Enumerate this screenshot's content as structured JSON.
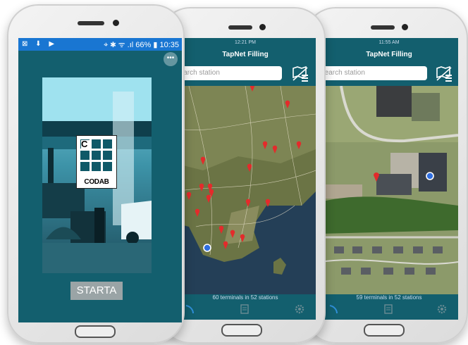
{
  "android": {
    "status_left": "⊠ ⬇ ▶",
    "status_right": "⌖ ✱ ᯤ .ıl 66% ▮ 10:35",
    "logo_letter": "C",
    "logo_name": "CODAB",
    "start_label": "STARTA"
  },
  "map_app": {
    "time": "12:21 PM",
    "title": "TapNet Filling",
    "search_placeholder": "Search station",
    "footer": "60 terminals in 52 stations"
  },
  "detail_app": {
    "time": "11:55 AM",
    "title": "TapNet Filling",
    "search_placeholder": "Search station",
    "footer": "59 terminals in 52 stations"
  },
  "colors": {
    "teal": "#135f6e",
    "status_blue": "#1976d2",
    "pin_red": "#e32b2b",
    "user_blue": "#2f6ee0"
  },
  "icons": [
    "map-list-icon",
    "navigation-icon",
    "list-icon",
    "settings-icon"
  ]
}
